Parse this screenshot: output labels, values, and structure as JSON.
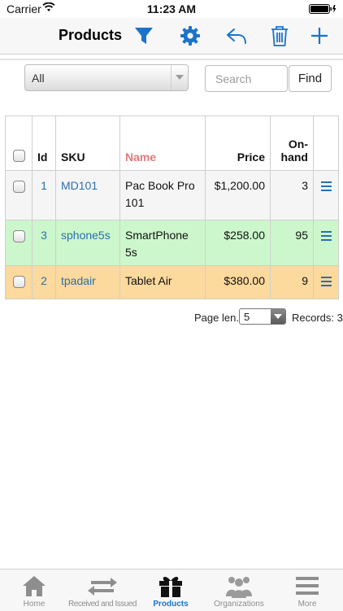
{
  "status": {
    "carrier": "Carrier",
    "time": "11:23 AM"
  },
  "navbar": {
    "title": "Products"
  },
  "filter": {
    "selected": "All",
    "search_placeholder": "Search",
    "find_label": "Find"
  },
  "table": {
    "headers": {
      "id": "Id",
      "sku": "SKU",
      "name": "Name",
      "price": "Price",
      "onhand": "On-hand"
    },
    "rows": [
      {
        "id": "1",
        "sku": "MD101",
        "name": "Pac Book Pro 101",
        "price": "$1,200.00",
        "onhand": "3",
        "color": "#f5f5f5"
      },
      {
        "id": "3",
        "sku": "sphone5s",
        "name": "SmartPhone 5s",
        "price": "$258.00",
        "onhand": "95",
        "color": "#ccf7cc"
      },
      {
        "id": "2",
        "sku": "tpadair",
        "name": "Tablet Air",
        "price": "$380.00",
        "onhand": "9",
        "color": "#fcd99d"
      }
    ]
  },
  "pager": {
    "page_len_label": "Page len.",
    "page_len": "5",
    "records_label": "Records: 3"
  },
  "tabs": [
    {
      "label": "Home",
      "icon": "home-icon"
    },
    {
      "label": "Received and Issued",
      "icon": "transfer-icon"
    },
    {
      "label": "Products",
      "icon": "gift-icon"
    },
    {
      "label": "Organizations",
      "icon": "people-icon"
    },
    {
      "label": "More",
      "icon": "menu-icon"
    }
  ],
  "colors": {
    "accent": "#1a73c9",
    "link": "#2a6fb0",
    "name_header": "#e07a7a"
  }
}
